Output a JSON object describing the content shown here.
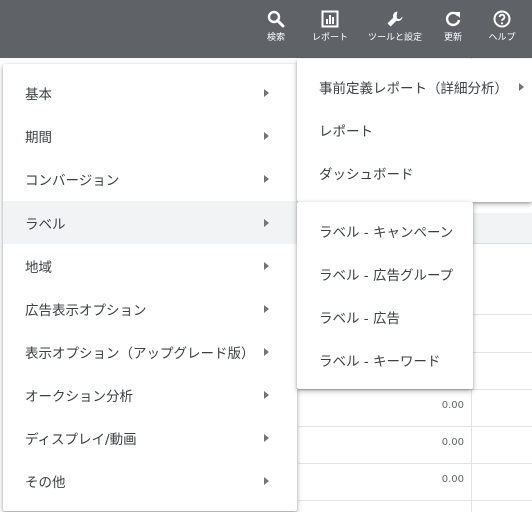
{
  "toolbar": {
    "items": [
      {
        "label": "検索",
        "icon": "search-icon"
      },
      {
        "label": "レポート",
        "icon": "report-icon"
      },
      {
        "label": "ツールと設定",
        "icon": "wrench-icon"
      },
      {
        "label": "更新",
        "icon": "refresh-icon"
      },
      {
        "label": "ヘルプ",
        "icon": "help-icon"
      }
    ]
  },
  "main_menu": {
    "items": [
      {
        "label": "基本"
      },
      {
        "label": "期間"
      },
      {
        "label": "コンバージョン"
      },
      {
        "label": "ラベル"
      },
      {
        "label": "地域"
      },
      {
        "label": "広告表示オプション"
      },
      {
        "label": "表示オプション（アップグレード版）"
      },
      {
        "label": "オークション分析"
      },
      {
        "label": "ディスプレイ/動画"
      },
      {
        "label": "その他"
      }
    ],
    "active_index": 3
  },
  "report_menu": {
    "items": [
      {
        "label": "事前定義レポート（詳細分析）"
      },
      {
        "label": "レポート"
      },
      {
        "label": "ダッシュボード"
      }
    ]
  },
  "label_submenu": {
    "items": [
      {
        "label": "ラベル - キャンペーン"
      },
      {
        "label": "ラベル - 広告グループ"
      },
      {
        "label": "ラベル - 広告"
      },
      {
        "label": "ラベル - キーワード"
      }
    ]
  },
  "background_table": {
    "values": [
      "0.00",
      "0.00",
      "0.00"
    ]
  },
  "colors": {
    "toolbar_bg": "#5f6368",
    "active_item_bg": "#f1f3f4",
    "text": "#3c4043"
  }
}
